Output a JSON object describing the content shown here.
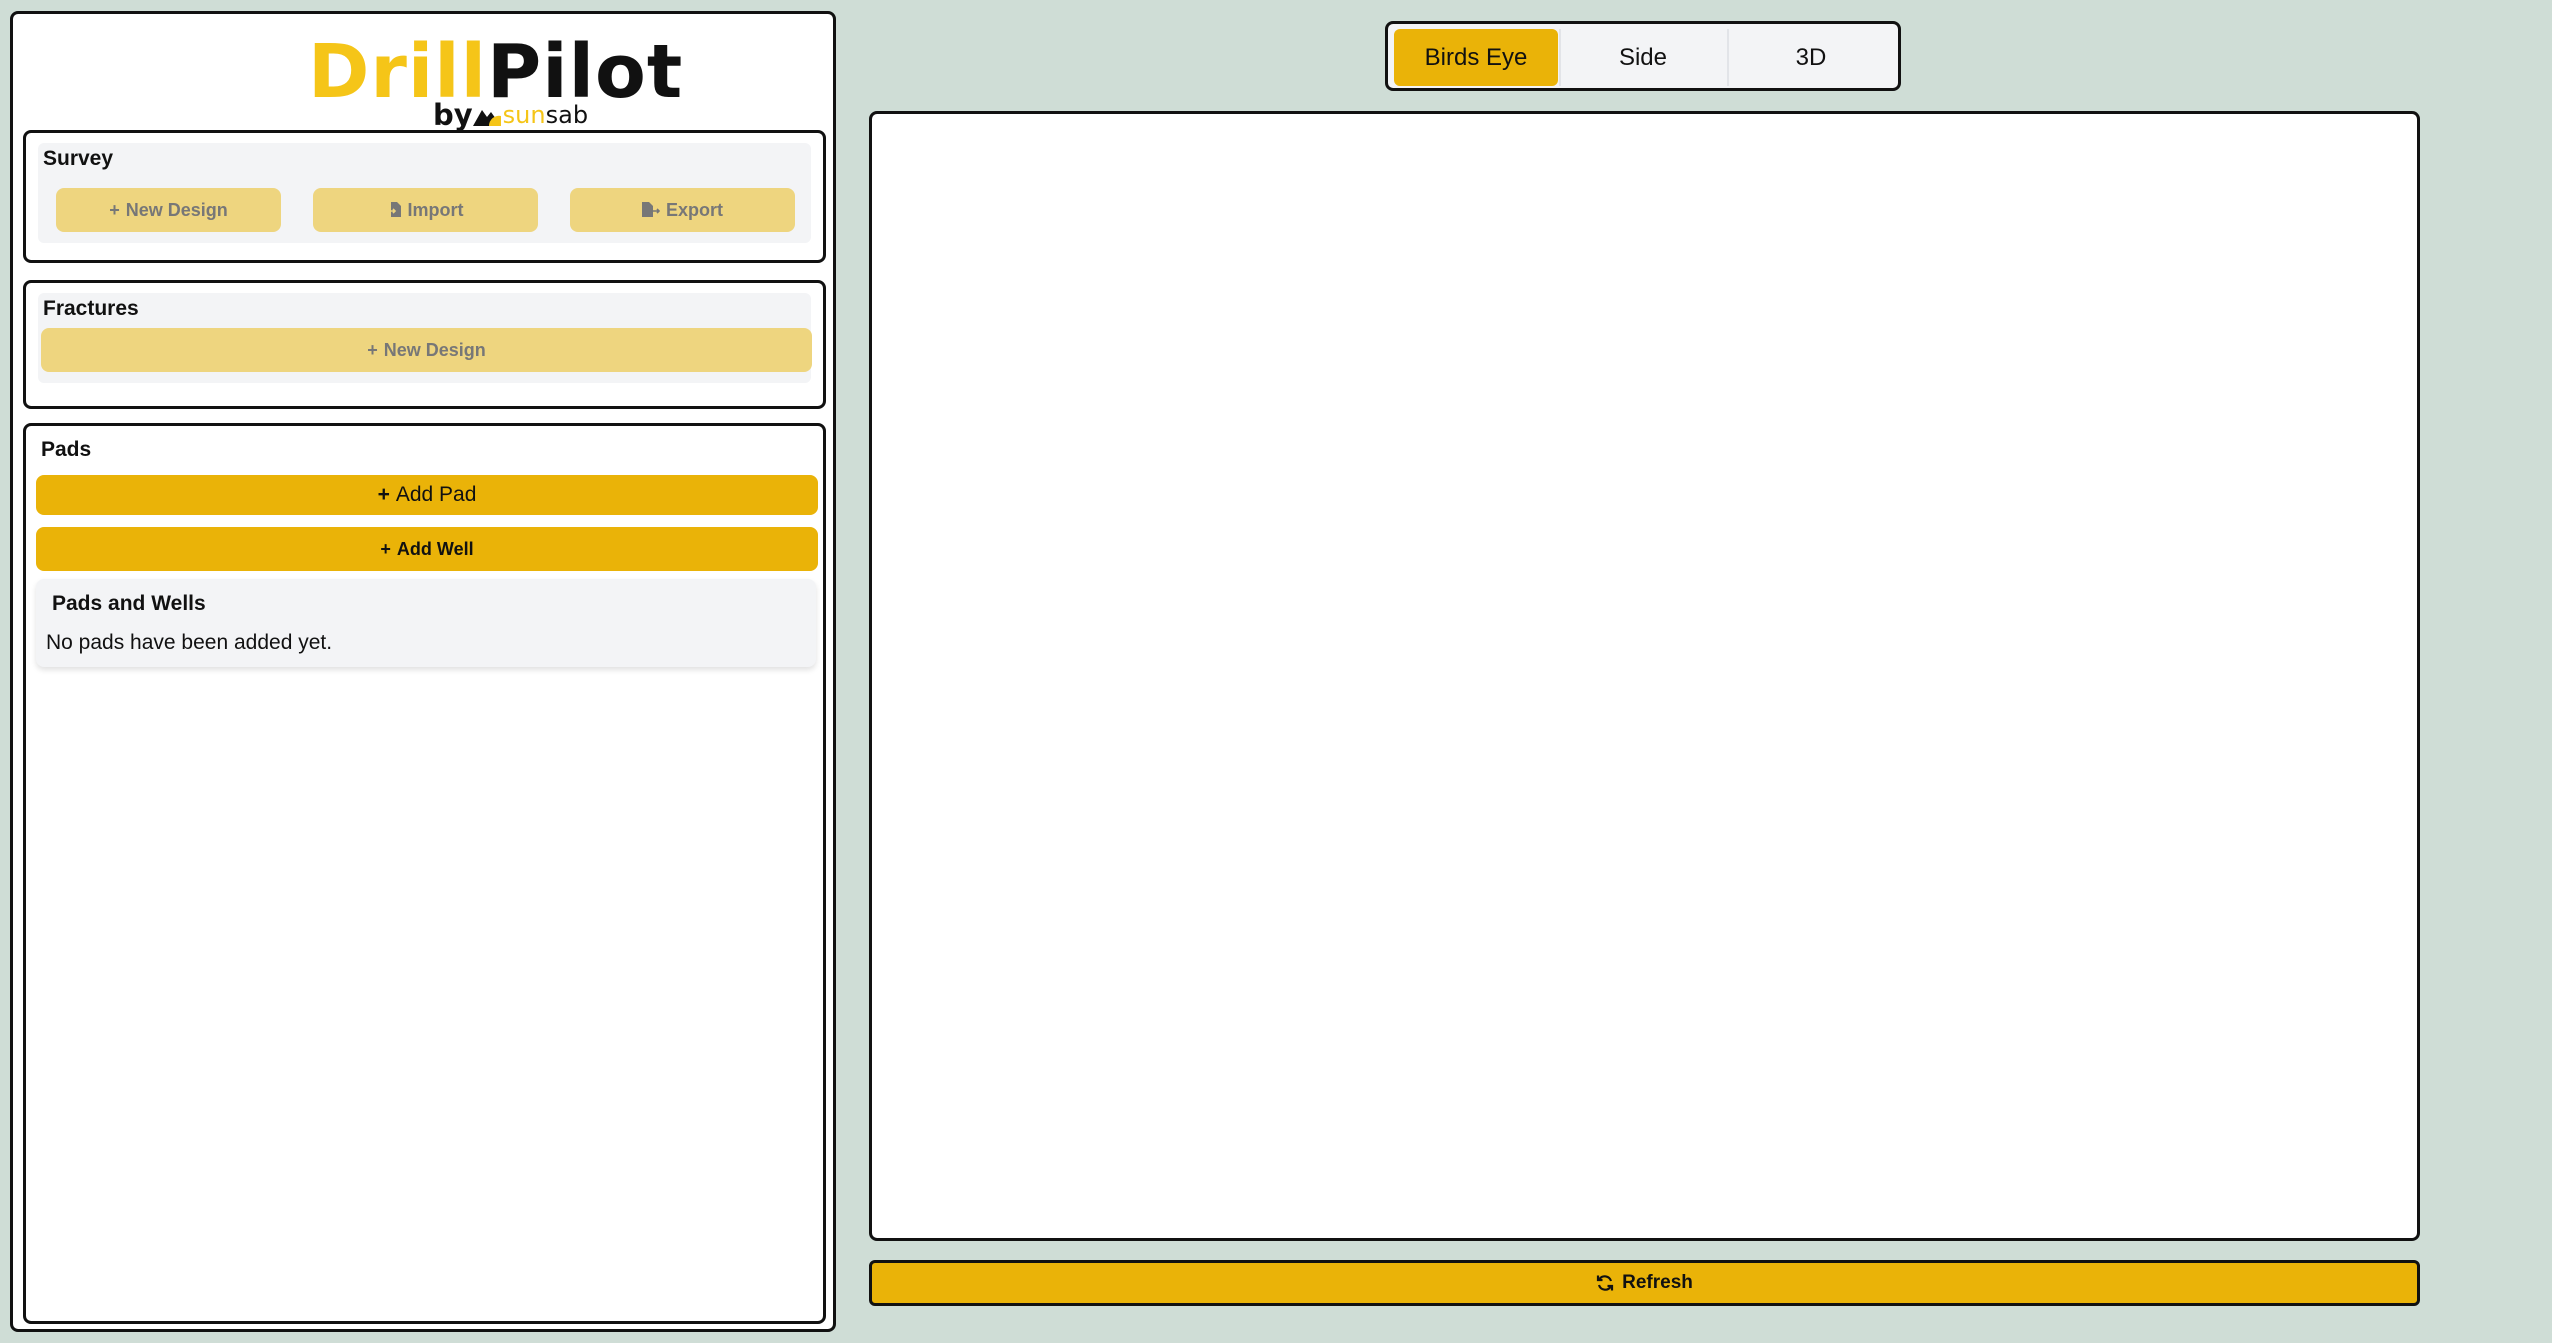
{
  "logo": {
    "drill": "Drill",
    "pilot": "Pilot",
    "by": "by",
    "sun": "sun",
    "sab": "sab"
  },
  "survey": {
    "title": "Survey",
    "new_design": "New Design",
    "import": "Import",
    "export": "Export"
  },
  "fractures": {
    "title": "Fractures",
    "new_design": "New Design"
  },
  "pads": {
    "title": "Pads",
    "add_pad": "Add Pad",
    "add_well": "Add Well",
    "list_title": "Pads and Wells",
    "empty_text": "No pads have been added yet."
  },
  "views": {
    "tabs": [
      "Birds Eye",
      "Side",
      "3D"
    ],
    "active": "Birds Eye"
  },
  "refresh": {
    "label": "Refresh"
  },
  "colors": {
    "accent": "#eab308",
    "accent_disabled": "#eed57f",
    "logo_yellow": "#f5c518",
    "background": "#cfddd6"
  }
}
